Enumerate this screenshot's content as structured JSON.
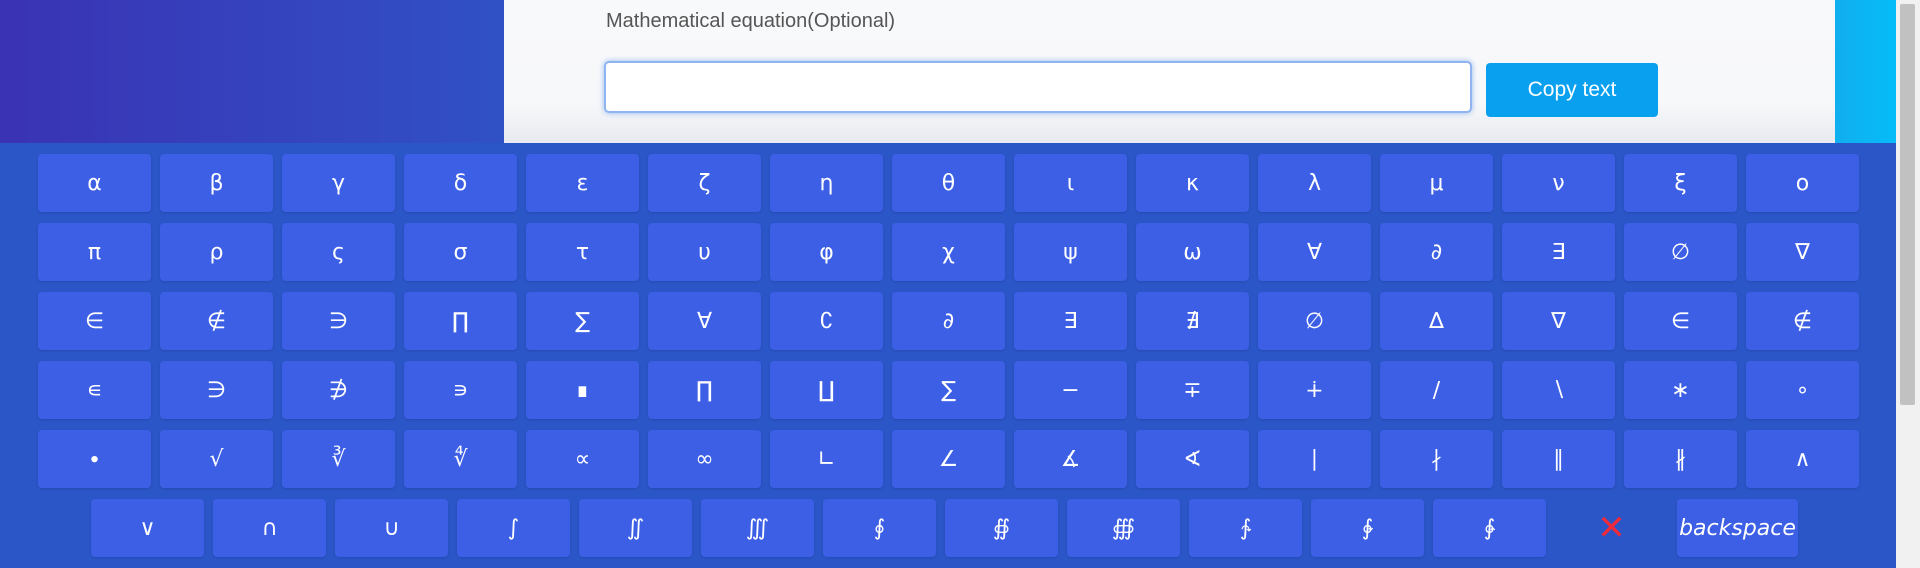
{
  "form": {
    "label": "Mathematical equation(Optional)",
    "input_value": "",
    "input_placeholder": "",
    "copy_button": "Copy text"
  },
  "keyboard": {
    "rows": [
      [
        "α",
        "β",
        "γ",
        "δ",
        "ε",
        "ζ",
        "η",
        "θ",
        "ι",
        "κ",
        "λ",
        "μ",
        "ν",
        "ξ",
        "ο"
      ],
      [
        "π",
        "ρ",
        "ς",
        "σ",
        "τ",
        "υ",
        "φ",
        "χ",
        "ψ",
        "ω",
        "∀",
        "∂",
        "∃",
        "∅",
        "∇"
      ],
      [
        "∈",
        "∉",
        "∋",
        "∏",
        "∑",
        "∀",
        "∁",
        "∂",
        "∃",
        "∄",
        "∅",
        "∆",
        "∇",
        "∈",
        "∉"
      ],
      [
        "∊",
        "∋",
        "∌",
        "∍",
        "∎",
        "∏",
        "∐",
        "∑",
        "−",
        "∓",
        "∔",
        "∕",
        "∖",
        "∗",
        "∘"
      ],
      [
        "∙",
        "√",
        "∛",
        "∜",
        "∝",
        "∞",
        "∟",
        "∠",
        "∡",
        "∢",
        "∣",
        "∤",
        "∥",
        "∦",
        "∧"
      ],
      [
        "∨",
        "∩",
        "∪",
        "∫",
        "∬",
        "∭",
        "∮",
        "∯",
        "∰",
        "∱",
        "∲",
        "∳"
      ]
    ],
    "close_icon": "✕",
    "backspace_label": "backspace",
    "key_color": "#3c5fe6",
    "background_color": "#2b56c8",
    "close_color": "#ee2b3b"
  }
}
